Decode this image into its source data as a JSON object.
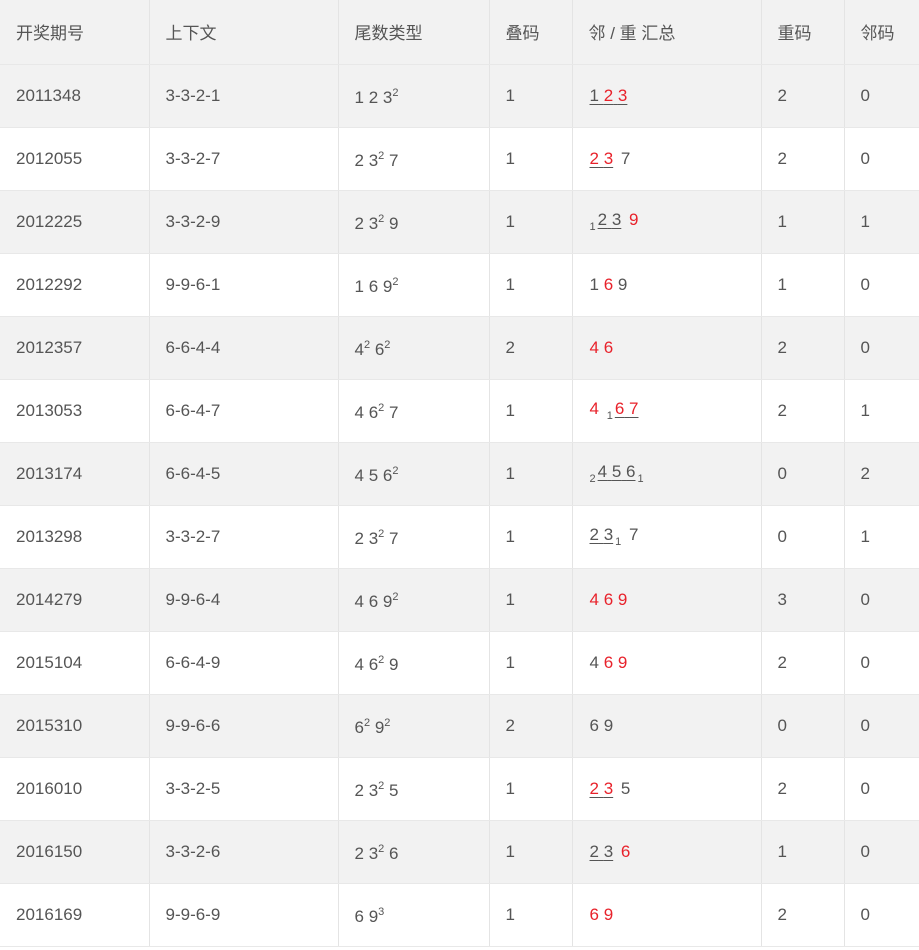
{
  "table": {
    "headers": [
      "开奖期号",
      "上下文",
      "尾数类型",
      "叠码",
      "邻 / 重 汇总",
      "重码",
      "邻码"
    ],
    "rows": [
      {
        "issue": "2011348",
        "ctx": "3-3-2-1",
        "tail": [
          [
            "1",
            ""
          ],
          [
            "2",
            ""
          ],
          [
            "3",
            "2"
          ]
        ],
        "overlap": "1",
        "summary": [
          {
            "u": true,
            "pre": "",
            "d": [
              [
                "1",
                "g"
              ],
              [
                "2",
                "r"
              ],
              [
                "3",
                "r"
              ]
            ],
            "post": ""
          }
        ],
        "repeat": "2",
        "adjacent": "0"
      },
      {
        "issue": "2012055",
        "ctx": "3-3-2-7",
        "tail": [
          [
            "2",
            ""
          ],
          [
            "3",
            "2"
          ],
          [
            "7",
            ""
          ]
        ],
        "overlap": "1",
        "summary": [
          {
            "u": true,
            "pre": "",
            "d": [
              [
                "2",
                "r"
              ],
              [
                "3",
                "r"
              ]
            ],
            "post": ""
          },
          {
            "u": false,
            "pre": "",
            "d": [
              [
                "7",
                "g"
              ]
            ],
            "post": ""
          }
        ],
        "repeat": "2",
        "adjacent": "0"
      },
      {
        "issue": "2012225",
        "ctx": "3-3-2-9",
        "tail": [
          [
            "2",
            ""
          ],
          [
            "3",
            "2"
          ],
          [
            "9",
            ""
          ]
        ],
        "overlap": "1",
        "summary": [
          {
            "u": true,
            "pre": "1",
            "d": [
              [
                "2",
                "g"
              ],
              [
                "3",
                "g"
              ]
            ],
            "post": ""
          },
          {
            "u": false,
            "pre": "",
            "d": [
              [
                "9",
                "r"
              ]
            ],
            "post": ""
          }
        ],
        "repeat": "1",
        "adjacent": "1"
      },
      {
        "issue": "2012292",
        "ctx": "9-9-6-1",
        "tail": [
          [
            "1",
            ""
          ],
          [
            "6",
            ""
          ],
          [
            "9",
            "2"
          ]
        ],
        "overlap": "1",
        "summary": [
          {
            "u": false,
            "pre": "",
            "d": [
              [
                "1",
                "g"
              ],
              [
                "6",
                "r"
              ],
              [
                "9",
                "g"
              ]
            ],
            "post": ""
          }
        ],
        "repeat": "1",
        "adjacent": "0"
      },
      {
        "issue": "2012357",
        "ctx": "6-6-4-4",
        "tail": [
          [
            "4",
            "2"
          ],
          [
            "6",
            "2"
          ]
        ],
        "overlap": "2",
        "summary": [
          {
            "u": false,
            "pre": "",
            "d": [
              [
                "4",
                "r"
              ],
              [
                "6",
                "r"
              ]
            ],
            "post": ""
          }
        ],
        "repeat": "2",
        "adjacent": "0"
      },
      {
        "issue": "2013053",
        "ctx": "6-6-4-7",
        "tail": [
          [
            "4",
            ""
          ],
          [
            "6",
            "2"
          ],
          [
            "7",
            ""
          ]
        ],
        "overlap": "1",
        "summary": [
          {
            "u": false,
            "pre": "",
            "d": [
              [
                "4",
                "r"
              ]
            ],
            "post": ""
          },
          {
            "u": true,
            "pre": "1",
            "d": [
              [
                "6",
                "r"
              ],
              [
                "7",
                "r"
              ]
            ],
            "post": ""
          }
        ],
        "repeat": "2",
        "adjacent": "1"
      },
      {
        "issue": "2013174",
        "ctx": "6-6-4-5",
        "tail": [
          [
            "4",
            ""
          ],
          [
            "5",
            ""
          ],
          [
            "6",
            "2"
          ]
        ],
        "overlap": "1",
        "summary": [
          {
            "u": true,
            "pre": "2",
            "d": [
              [
                "4",
                "g"
              ],
              [
                "5",
                "g"
              ],
              [
                "6",
                "g"
              ]
            ],
            "post": "1"
          }
        ],
        "repeat": "0",
        "adjacent": "2"
      },
      {
        "issue": "2013298",
        "ctx": "3-3-2-7",
        "tail": [
          [
            "2",
            ""
          ],
          [
            "3",
            "2"
          ],
          [
            "7",
            ""
          ]
        ],
        "overlap": "1",
        "summary": [
          {
            "u": true,
            "pre": "",
            "d": [
              [
                "2",
                "g"
              ],
              [
                "3",
                "g"
              ]
            ],
            "post": "1"
          },
          {
            "u": false,
            "pre": "",
            "d": [
              [
                "7",
                "g"
              ]
            ],
            "post": ""
          }
        ],
        "repeat": "0",
        "adjacent": "1"
      },
      {
        "issue": "2014279",
        "ctx": "9-9-6-4",
        "tail": [
          [
            "4",
            ""
          ],
          [
            "6",
            ""
          ],
          [
            "9",
            "2"
          ]
        ],
        "overlap": "1",
        "summary": [
          {
            "u": false,
            "pre": "",
            "d": [
              [
                "4",
                "r"
              ],
              [
                "6",
                "r"
              ],
              [
                "9",
                "r"
              ]
            ],
            "post": ""
          }
        ],
        "repeat": "3",
        "adjacent": "0"
      },
      {
        "issue": "2015104",
        "ctx": "6-6-4-9",
        "tail": [
          [
            "4",
            ""
          ],
          [
            "6",
            "2"
          ],
          [
            "9",
            ""
          ]
        ],
        "overlap": "1",
        "summary": [
          {
            "u": false,
            "pre": "",
            "d": [
              [
                "4",
                "g"
              ],
              [
                "6",
                "r"
              ],
              [
                "9",
                "r"
              ]
            ],
            "post": ""
          }
        ],
        "repeat": "2",
        "adjacent": "0"
      },
      {
        "issue": "2015310",
        "ctx": "9-9-6-6",
        "tail": [
          [
            "6",
            "2"
          ],
          [
            "9",
            "2"
          ]
        ],
        "overlap": "2",
        "summary": [
          {
            "u": false,
            "pre": "",
            "d": [
              [
                "6",
                "g"
              ],
              [
                "9",
                "g"
              ]
            ],
            "post": ""
          }
        ],
        "repeat": "0",
        "adjacent": "0"
      },
      {
        "issue": "2016010",
        "ctx": "3-3-2-5",
        "tail": [
          [
            "2",
            ""
          ],
          [
            "3",
            "2"
          ],
          [
            "5",
            ""
          ]
        ],
        "overlap": "1",
        "summary": [
          {
            "u": true,
            "pre": "",
            "d": [
              [
                "2",
                "r"
              ],
              [
                "3",
                "r"
              ]
            ],
            "post": ""
          },
          {
            "u": false,
            "pre": "",
            "d": [
              [
                "5",
                "g"
              ]
            ],
            "post": ""
          }
        ],
        "repeat": "2",
        "adjacent": "0"
      },
      {
        "issue": "2016150",
        "ctx": "3-3-2-6",
        "tail": [
          [
            "2",
            ""
          ],
          [
            "3",
            "2"
          ],
          [
            "6",
            ""
          ]
        ],
        "overlap": "1",
        "summary": [
          {
            "u": true,
            "pre": "",
            "d": [
              [
                "2",
                "g"
              ],
              [
                "3",
                "g"
              ]
            ],
            "post": ""
          },
          {
            "u": false,
            "pre": "",
            "d": [
              [
                "6",
                "r"
              ]
            ],
            "post": ""
          }
        ],
        "repeat": "1",
        "adjacent": "0"
      },
      {
        "issue": "2016169",
        "ctx": "9-9-6-9",
        "tail": [
          [
            "6",
            ""
          ],
          [
            "9",
            "3"
          ]
        ],
        "overlap": "1",
        "summary": [
          {
            "u": false,
            "pre": "",
            "d": [
              [
                "6",
                "r"
              ],
              [
                "9",
                "r"
              ]
            ],
            "post": ""
          }
        ],
        "repeat": "2",
        "adjacent": "0"
      }
    ]
  },
  "colors": {
    "highlight": "#e8222b",
    "text": "#555555",
    "row_alt": "#f2f2f2",
    "row_plain": "#ffffff"
  }
}
